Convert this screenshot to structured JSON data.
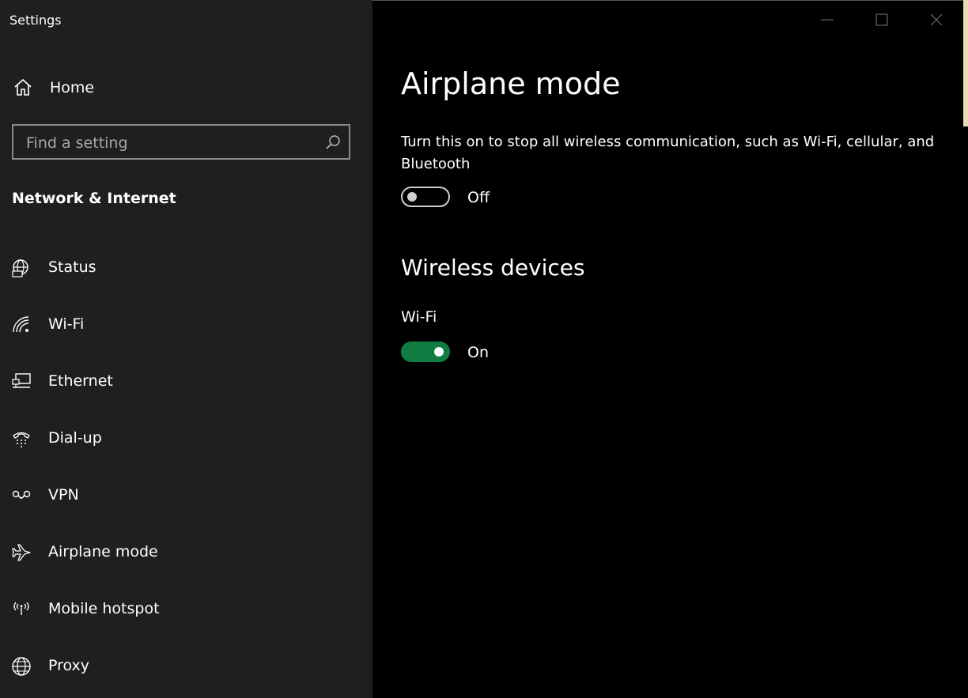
{
  "window": {
    "title": "Settings",
    "caption_buttons": [
      "minimize-icon",
      "maximize-icon",
      "close-icon"
    ]
  },
  "sidebar": {
    "home_label": "Home",
    "search_placeholder": "Find a setting",
    "section_title": "Network & Internet",
    "items": [
      {
        "label": "Status",
        "icon": "globe-status-icon"
      },
      {
        "label": "Wi-Fi",
        "icon": "wifi-icon"
      },
      {
        "label": "Ethernet",
        "icon": "ethernet-icon"
      },
      {
        "label": "Dial-up",
        "icon": "dialup-icon"
      },
      {
        "label": "VPN",
        "icon": "vpn-icon"
      },
      {
        "label": "Airplane mode",
        "icon": "airplane-icon"
      },
      {
        "label": "Mobile hotspot",
        "icon": "hotspot-icon"
      },
      {
        "label": "Proxy",
        "icon": "globe-icon"
      }
    ]
  },
  "main": {
    "title": "Airplane mode",
    "description": "Turn this on to stop all wireless communication, such as Wi-Fi, cellular, and Bluetooth",
    "airplane_toggle": {
      "state_text": "Off",
      "on": false
    },
    "wireless_title": "Wireless devices",
    "wifi": {
      "label": "Wi-Fi",
      "state_text": "On",
      "on": true
    }
  },
  "colors": {
    "sidebar_bg": "#1f1f1f",
    "main_bg": "#000000",
    "toggle_on": "#107c41"
  }
}
